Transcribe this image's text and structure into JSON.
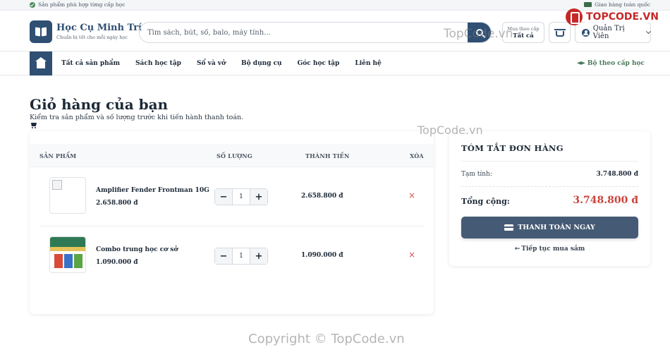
{
  "topbar": {
    "left_text": "Sản phẩm phù hợp từng cấp học",
    "right_text": "Giao hàng toàn quốc"
  },
  "header": {
    "logo_title": "Học Cụ Minh Trí",
    "logo_subtitle": "Chuẩn bị tốt cho mỗi ngày học",
    "search_placeholder": "Tìm sách, bút, sổ, balo, máy tính...",
    "level_label": "Mua theo cấp",
    "level_value": "Tất cả",
    "user_name": "Quản Trị Viên"
  },
  "nav": {
    "items": [
      "Tất cả sản phẩm",
      "Sách học tập",
      "Sổ và vở",
      "Bộ dụng cụ",
      "Góc học tập",
      "Liên hệ"
    ],
    "right_label": "Bộ theo cấp học"
  },
  "page": {
    "title": "Giỏ hàng của bạn",
    "subtitle": "Kiểm tra sản phẩm và số lượng trước khi tiến hành thanh toán."
  },
  "cart": {
    "columns": [
      "SẢN PHẨM",
      "SỐ LƯỢNG",
      "THÀNH TIỀN",
      "XÓA"
    ],
    "items": [
      {
        "name": "Amplifier Fender Frontman 10G",
        "price": "2.658.800 đ",
        "qty": "1",
        "total": "2.658.800 đ",
        "remove": "×"
      },
      {
        "name": "Combo trung học cơ sở",
        "price": "1.090.000 đ",
        "qty": "1",
        "total": "1.090.000 đ",
        "remove": "×"
      }
    ]
  },
  "summary": {
    "title": "TÓM TẮT ĐƠN HÀNG",
    "subtotal_label": "Tạm tính:",
    "subtotal_value": "3.748.800 đ",
    "total_label": "Tổng cộng:",
    "total_value": "3.748.800 đ",
    "checkout_label": "THANH TOÁN NGAY",
    "continue_label": "Tiếp tục mua sắm"
  },
  "watermarks": {
    "wm1": "TopCode.vn",
    "wm2": "TopCode.vn",
    "wm3": "Copyright © TopCode.vn",
    "brand": "TOPCODE.VN"
  },
  "colors": {
    "primary": "#2f4f73",
    "checkout": "#455a74",
    "total_red": "#c9453c",
    "remove_red": "#d9534f",
    "accent_green": "#4a7a5a"
  }
}
